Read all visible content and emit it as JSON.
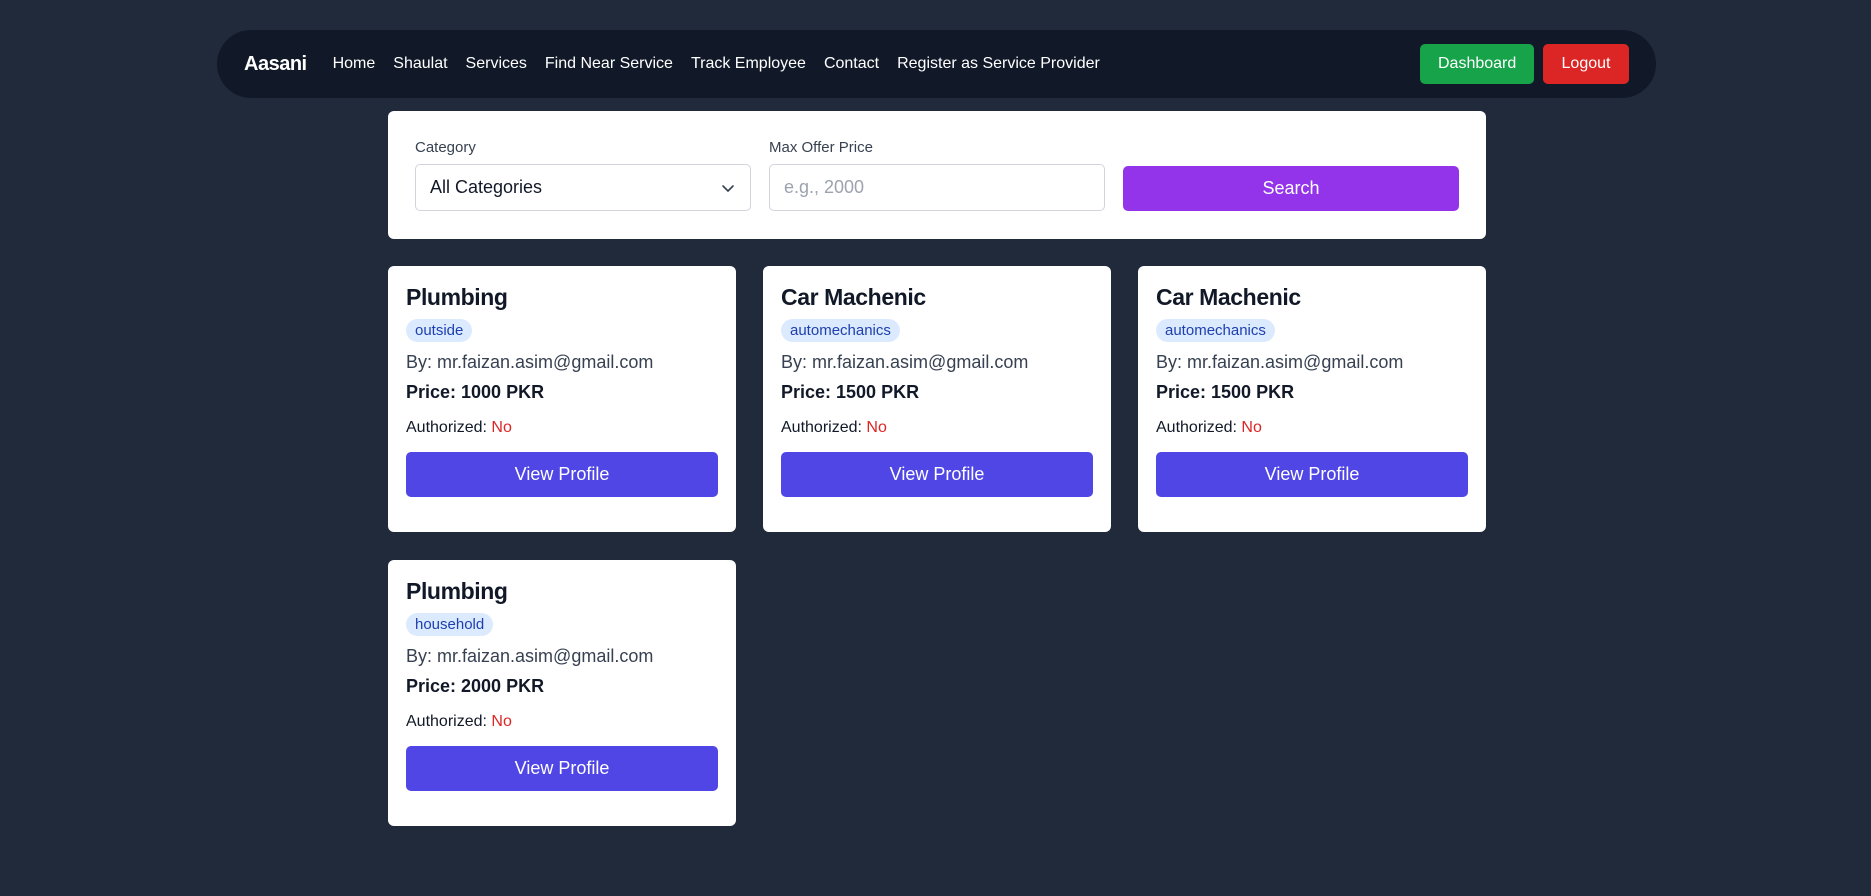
{
  "navbar": {
    "brand": "Aasani",
    "links": [
      "Home",
      "Shaulat",
      "Services",
      "Find Near Service",
      "Track Employee",
      "Contact",
      "Register as Service Provider"
    ],
    "dashboard_label": "Dashboard",
    "logout_label": "Logout"
  },
  "filters": {
    "category_label": "Category",
    "category_value": "All Categories",
    "price_label": "Max Offer Price",
    "price_placeholder": "e.g., 2000",
    "search_label": "Search"
  },
  "cards": [
    {
      "title": "Plumbing",
      "tag": "outside",
      "by": "By: mr.faizan.asim@gmail.com",
      "price": "Price: 1000 PKR",
      "auth_label": "Authorized:",
      "auth_value": "No",
      "button": "View Profile"
    },
    {
      "title": "Car Machenic",
      "tag": "automechanics",
      "by": "By: mr.faizan.asim@gmail.com",
      "price": "Price: 1500 PKR",
      "auth_label": "Authorized:",
      "auth_value": "No",
      "button": "View Profile"
    },
    {
      "title": "Car Machenic",
      "tag": "automechanics",
      "by": "By: mr.faizan.asim@gmail.com",
      "price": "Price: 1500 PKR",
      "auth_label": "Authorized:",
      "auth_value": "No",
      "button": "View Profile"
    },
    {
      "title": "Plumbing",
      "tag": "household",
      "by": "By: mr.faizan.asim@gmail.com",
      "price": "Price: 2000 PKR",
      "auth_label": "Authorized:",
      "auth_value": "No",
      "button": "View Profile"
    }
  ],
  "colors": {
    "background": "#212a3b",
    "navbar": "#111827",
    "dashboard": "#16a34a",
    "logout": "#dc2626",
    "search": "#9333ea",
    "view_profile": "#4f46e5",
    "tag_bg": "#dbeafe",
    "authorized_no": "#dc2626"
  }
}
